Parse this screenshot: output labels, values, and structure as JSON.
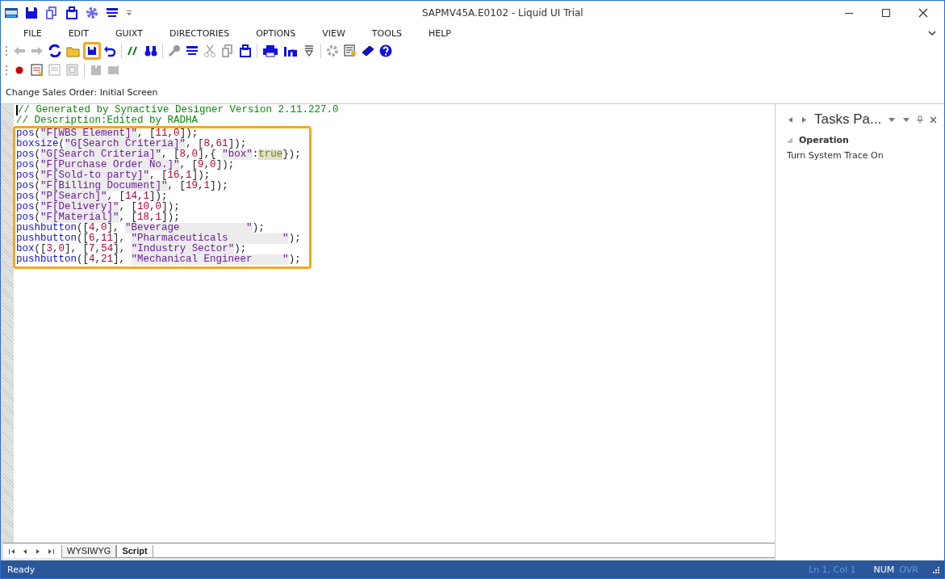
{
  "window": {
    "title": "SAPMV45A.E0102 - Liquid UI Trial"
  },
  "menu": [
    "FILE",
    "EDIT",
    "GUIXT",
    "DIRECTORIES",
    "OPTIONS",
    "VIEW",
    "TOOLS",
    "HELP"
  ],
  "toolbar": {
    "save_highlighted": true
  },
  "screen_label": "Change Sales Order: Initial Screen",
  "editor": {
    "comments": [
      "// Generated by Synactive Designer Version 2.11.227.0",
      "// Description:Edited by RADHA"
    ],
    "highlighted_lines": [
      "pos(\"F[WBS Element]\", [11,0]);",
      "boxsize(\"G[Search Criteria]\", [8,61]);",
      "pos(\"G[Search Criteria]\", [8,0],{ \"box\":true});",
      "pos(\"F[Purchase Order No.]\", [9,0]);",
      "pos(\"F[Sold-to party]\", [16,1]);",
      "pos(\"F[Billing Document]\", [19,1]);",
      "pos(\"P[Search]\", [14,1]);",
      "pos(\"F[Delivery]\", [10,0]);",
      "pos(\"F[Material]\", [18,1]);",
      "pushbutton([4,0], \"Beverage           \");",
      "pushbutton([6,11], \"Pharmaceuticals         \");",
      "box([3,0], [7,54], \"Industry Sector\");",
      "pushbutton([4,21], \"Mechanical Engineer     \");"
    ]
  },
  "sheet_tabs": [
    {
      "label": "WYSIWYG",
      "selected": false
    },
    {
      "label": "Script",
      "selected": true
    }
  ],
  "tasks_pane": {
    "title": "Tasks Pa...",
    "section": "Operation",
    "items": [
      "Turn System Trace On"
    ]
  },
  "status_bar": {
    "message": "Ready",
    "position": "Ln 1, Col 1",
    "num": "NUM",
    "ovr": "OVR"
  }
}
